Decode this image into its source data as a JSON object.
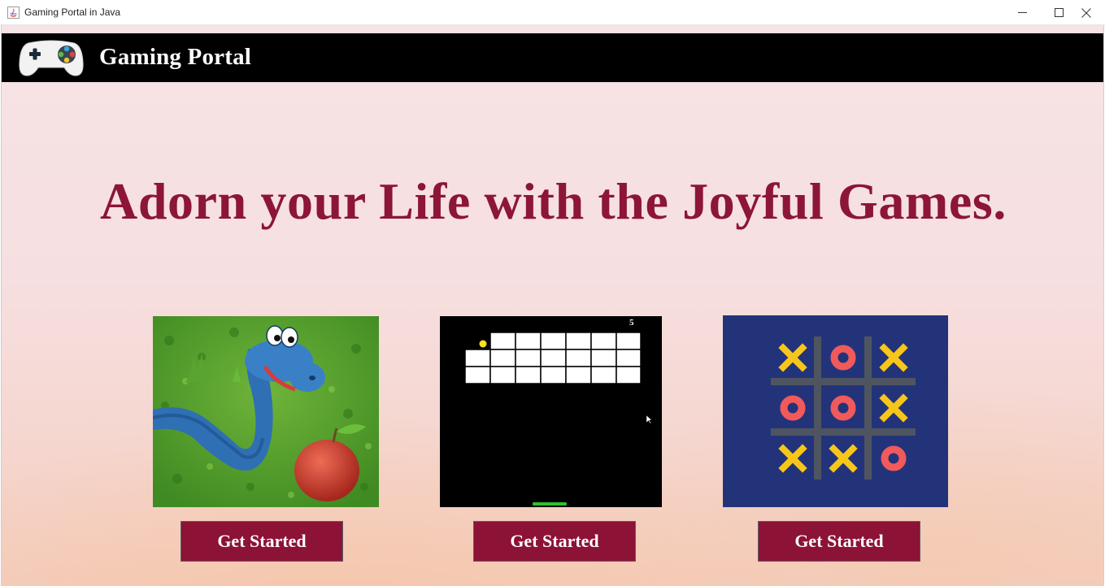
{
  "window": {
    "title": "Gaming Portal in Java"
  },
  "header": {
    "brand": "Gaming Portal"
  },
  "hero": {
    "headline": "Adorn your Life with the Joyful Games."
  },
  "games": [
    {
      "name": "snake",
      "image_icon": "snake-game-icon",
      "button_label": "Get Started"
    },
    {
      "name": "brick-breaker",
      "image_icon": "brick-breaker-game-icon",
      "score": "5",
      "button_label": "Get Started"
    },
    {
      "name": "tic-tac-toe",
      "image_icon": "tic-tac-toe-game-icon",
      "button_label": "Get Started"
    }
  ],
  "colors": {
    "accent": "#8c1236",
    "headline": "#8c1538",
    "header_bg": "#000000",
    "tictactoe_bg": "#23337a",
    "x_mark": "#f7c61a",
    "o_mark": "#f05a5b"
  }
}
